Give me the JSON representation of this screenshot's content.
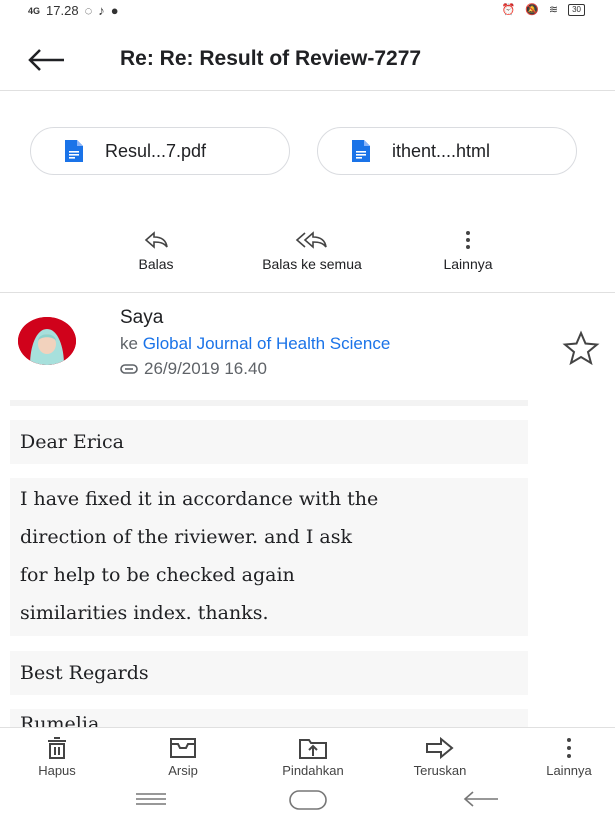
{
  "status": {
    "signal": "4G",
    "time": "17.28",
    "battery": "30"
  },
  "app_bar": {
    "title": "Re: Re: Result of Review-7277"
  },
  "attachments": [
    {
      "name": "Resul...7.pdf"
    },
    {
      "name": "ithent....html"
    }
  ],
  "actions": {
    "reply": "Balas",
    "reply_all": "Balas ke semua",
    "more": "Lainnya"
  },
  "message": {
    "sender": "Saya",
    "to_prefix": "ke",
    "to": "Global Journal of Health Science",
    "date": "26/9/2019 16.40",
    "greeting": "Dear Erica",
    "body_lines": [
      "I have fixed it in accordance with the",
      "direction of the riviewer. and I ask",
      "for help to be checked again",
      "similarities index. thanks."
    ],
    "closing": "Best Regards",
    "signature_partial": "Rumelia"
  },
  "bottom_nav": {
    "delete": "Hapus",
    "archive": "Arsip",
    "move": "Pindahkan",
    "forward": "Teruskan",
    "more": "Lainnya"
  },
  "colors": {
    "link": "#1a73e8",
    "file_icon": "#1a73e8",
    "avatar_bg": "#d0021b"
  }
}
